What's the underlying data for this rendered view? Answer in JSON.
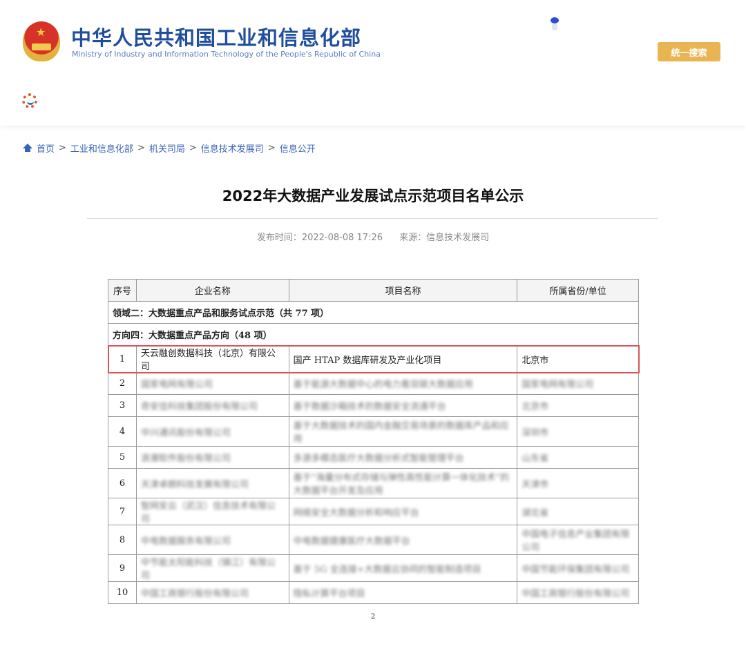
{
  "header": {
    "cn_name": "中华人民共和国工业和信息化部",
    "en_name": "Ministry of Industry and Information Technology of the People's Republic of China",
    "search_button": "统一搜索"
  },
  "breadcrumb": [
    "首页",
    "工业和信息化部",
    "机关司局",
    "信息技术发展司",
    "信息公开"
  ],
  "article": {
    "title": "2022年大数据产业发展试点示范项目名单公示",
    "publish_time": "发布时间：2022-08-08 17:26",
    "source": "来源：信息技术发展司"
  },
  "table": {
    "headers": [
      "序号",
      "企业名称",
      "项目名称",
      "所属省份/单位"
    ],
    "section": "领域二：大数据重点产品和服务试点示范（共 77 项）",
    "subsection": "方向四：大数据重点产品方向（48 项）",
    "rows": [
      [
        "1",
        "天云融创数据科技（北京）有限公司",
        "国产 HTAP 数据库研发及产业化项目",
        "北京市"
      ],
      [
        "2",
        "国家电网有限公司",
        "基于能源大数据中心的电力看双碳大数据应用",
        "国家电网有限公司"
      ],
      [
        "3",
        "奇安信科技集团股份有限公司",
        "基于数据沙箱技术的数据安全流通平台",
        "北京市"
      ],
      [
        "4",
        "中兴通讯股份有限公司",
        "基于大数据技术的国内金融交易场景的数据库产品和应用",
        "深圳市"
      ],
      [
        "5",
        "浪潮软件股份有限公司",
        "多源多模态医疗大数据分析式智能管理平台",
        "山东省"
      ],
      [
        "6",
        "天津卓朗科技发展有限公司",
        "基于“海量分布式存储与弹性高性能计算一体化技术”的大数据平台开发及应用",
        "天津市"
      ],
      [
        "7",
        "智网安云（武汉）信息技术有限公司",
        "网络安全大数据分析和响应平台",
        "湖北省"
      ],
      [
        "8",
        "中电数据服务有限公司",
        "中电数据健康医疗大数据平台",
        "中国电子信息产业集团有限公司"
      ],
      [
        "9",
        "中节能太阳能科技（镇江）有限公司",
        "基于 5G 全连接+大数据云协同的智能制造项目",
        "中国节能环保集团有限公司"
      ],
      [
        "10",
        "中国工商银行股份有限公司",
        "隐私计算平台项目",
        "中国工商银行股份有限公司"
      ]
    ]
  },
  "page_number": "2"
}
